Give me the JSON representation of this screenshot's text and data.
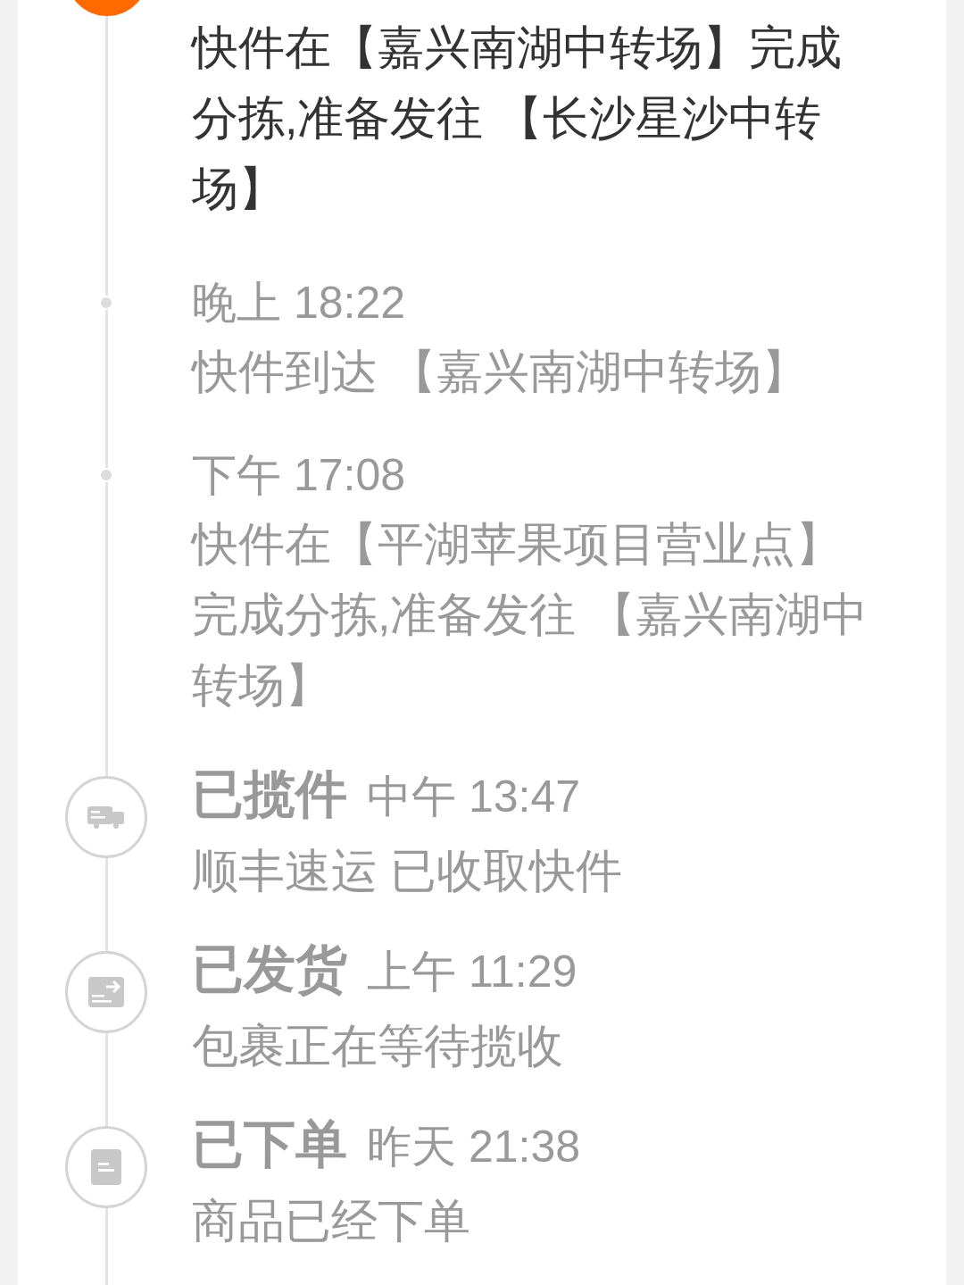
{
  "events": [
    {
      "kind": "current",
      "text": "快件在【嘉兴南湖中转场】完成分拣,准备发往 【长沙星沙中转场】"
    },
    {
      "kind": "detail",
      "time": "晚上 18:22",
      "text": "快件到达 【嘉兴南湖中转场】"
    },
    {
      "kind": "detail",
      "time": "下午 17:08",
      "text": "快件在【平湖苹果项目营业点】完成分拣,准备发往 【嘉兴南湖中转场】"
    },
    {
      "kind": "picked_up",
      "status": "已揽件",
      "time": "中午 13:47",
      "text": "顺丰速运 已收取快件"
    },
    {
      "kind": "shipped",
      "status": "已发货",
      "time": "上午 11:29",
      "text": "包裹正在等待揽收"
    },
    {
      "kind": "ordered",
      "status": "已下单",
      "time": "昨天 21:38",
      "text": "商品已经下单"
    }
  ]
}
